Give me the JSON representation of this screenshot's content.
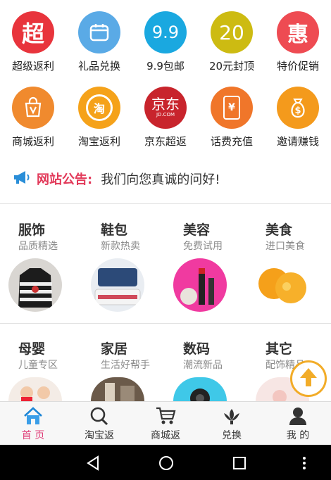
{
  "quick_links_row1": [
    {
      "label": "超级返利",
      "glyph": "超",
      "color": "#e8343c",
      "icon": "chao-icon"
    },
    {
      "label": "礼品兑换",
      "glyph": "",
      "color": "#5aaae6",
      "icon": "calendar-icon"
    },
    {
      "label": "9.9包邮",
      "glyph": "9.9",
      "color": "#1aa8e0",
      "icon": "nine-nine-icon"
    },
    {
      "label": "20元封顶",
      "glyph": "20",
      "color": "#cdbb12",
      "icon": "twenty-icon"
    },
    {
      "label": "特价促销",
      "glyph": "惠",
      "color": "#ee4b52",
      "icon": "hui-icon"
    }
  ],
  "quick_links_row2": [
    {
      "label": "商城返利",
      "glyph": "V",
      "color": "#f08a2e",
      "icon": "shopping-bag-icon"
    },
    {
      "label": "淘宝返利",
      "glyph": "淘",
      "color": "#f5a21a",
      "icon": "taobao-icon"
    },
    {
      "label": "京东超返",
      "glyph": "京东",
      "sub": "JD.COM",
      "color": "#c8242c",
      "icon": "jd-icon"
    },
    {
      "label": "话费充值",
      "glyph": "¥",
      "color": "#f0762a",
      "icon": "phone-recharge-icon"
    },
    {
      "label": "邀请赚钱",
      "glyph": "$",
      "color": "#f49a1c",
      "icon": "money-bag-icon"
    }
  ],
  "notice": {
    "title": "网站公告:",
    "message": "我们向您真诚的问好!",
    "icon": "megaphone-icon"
  },
  "categories_row1": [
    {
      "name": "服饰",
      "sub": "品质精选",
      "image": "striped-sweater"
    },
    {
      "name": "鞋包",
      "sub": "新款热卖",
      "image": "bags"
    },
    {
      "name": "美容",
      "sub": "免费试用",
      "image": "cosmetics"
    },
    {
      "name": "美食",
      "sub": "进口美食",
      "image": "oranges"
    }
  ],
  "categories_row2": [
    {
      "name": "母婴",
      "sub": "儿童专区",
      "image": "kids"
    },
    {
      "name": "家居",
      "sub": "生活好帮手",
      "image": "furniture"
    },
    {
      "name": "数码",
      "sub": "潮流新品",
      "image": "gadget"
    },
    {
      "name": "其它",
      "sub": "配饰精品",
      "image": "accessories"
    }
  ],
  "back_to_top": {
    "icon": "arrow-up-icon",
    "color": "#f2a81d"
  },
  "tabbar": [
    {
      "label": "首 页",
      "icon": "home-icon",
      "active": true
    },
    {
      "label": "淘宝返",
      "icon": "search-icon",
      "active": false
    },
    {
      "label": "商城返",
      "icon": "cart-icon",
      "active": false
    },
    {
      "label": "兑换",
      "icon": "lotus-icon",
      "active": false
    },
    {
      "label": "我 的",
      "icon": "user-icon",
      "active": false
    }
  ],
  "colors": {
    "accent": "#e0407a",
    "notice_title": "#e23a5a"
  }
}
